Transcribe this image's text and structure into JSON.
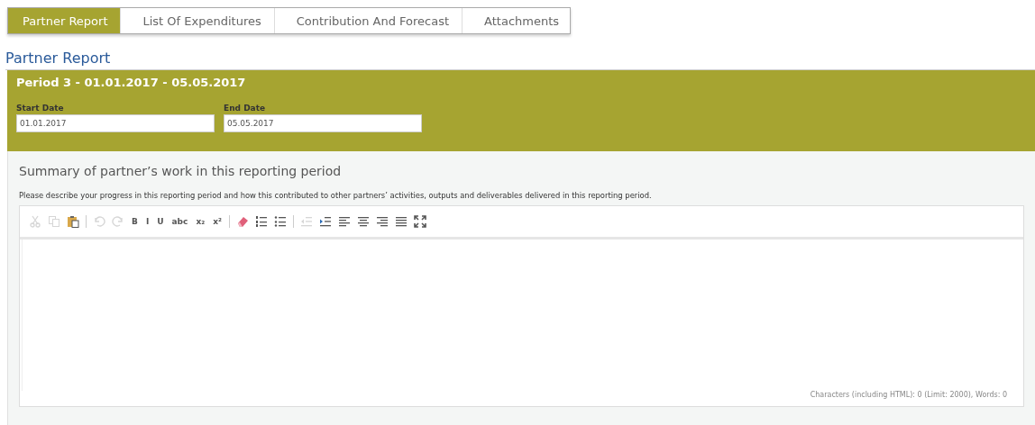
{
  "steps": [
    {
      "label": "Partner Report",
      "selected": true
    },
    {
      "label": "List Of Expenditures",
      "selected": false
    },
    {
      "label": "Contribution And Forecast",
      "selected": false
    },
    {
      "label": "Attachments",
      "selected": false
    }
  ],
  "page_title": "Partner Report",
  "period": {
    "title": "Period 3 - 01.01.2017 - 05.05.2017",
    "fields": [
      {
        "label": "Start Date",
        "value": "01.01.2017"
      },
      {
        "label": "End Date",
        "value": "05.05.2017"
      }
    ]
  },
  "summary": {
    "heading": "Summary of partner’s work in this reporting period",
    "description": "Please describe your progress in this reporting period and how this contributed to other partners’ activities, outputs and deliverables delivered in this reporting period.",
    "toolbar": [
      {
        "kind": "cut",
        "disabled": true
      },
      {
        "kind": "copy",
        "disabled": true
      },
      {
        "kind": "paste",
        "disabled": false
      },
      {
        "kind": "sep"
      },
      {
        "kind": "undo",
        "disabled": true
      },
      {
        "kind": "redo",
        "disabled": true
      },
      {
        "kind": "text",
        "label": "B",
        "disabled": false
      },
      {
        "kind": "text",
        "label": "I",
        "disabled": false
      },
      {
        "kind": "text",
        "label": "U",
        "disabled": false
      },
      {
        "kind": "text",
        "label": "abc",
        "disabled": false
      },
      {
        "kind": "text",
        "label": "x₂",
        "disabled": false
      },
      {
        "kind": "text",
        "label": "x²",
        "disabled": false
      },
      {
        "kind": "sep"
      },
      {
        "kind": "eraser",
        "disabled": false
      },
      {
        "kind": "numbered",
        "disabled": false
      },
      {
        "kind": "bulleted",
        "disabled": false
      },
      {
        "kind": "sep"
      },
      {
        "kind": "outdent",
        "disabled": true
      },
      {
        "kind": "indent",
        "disabled": false
      },
      {
        "kind": "left",
        "disabled": false
      },
      {
        "kind": "center",
        "disabled": false
      },
      {
        "kind": "right",
        "disabled": false
      },
      {
        "kind": "justify",
        "disabled": false
      },
      {
        "kind": "maximize",
        "disabled": false
      }
    ],
    "counter": "Characters (including HTML): 0 (Limit: 2000), Words: 0"
  }
}
